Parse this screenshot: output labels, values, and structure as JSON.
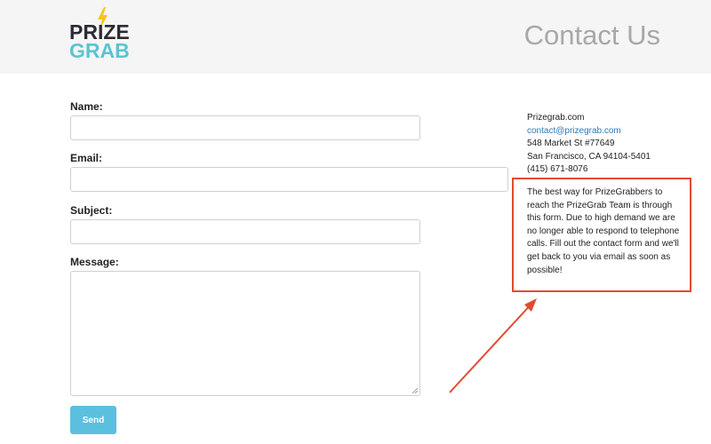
{
  "header": {
    "logo_top": "PRIZE",
    "logo_bottom": "GRAB",
    "title": "Contact Us"
  },
  "form": {
    "name_label": "Name:",
    "email_label": "Email:",
    "subject_label": "Subject:",
    "message_label": "Message:",
    "name_value": "",
    "email_value": "",
    "subject_value": "",
    "message_value": "",
    "send_label": "Send"
  },
  "contact": {
    "company": "Prizegrab.com",
    "email": "contact@prizegrab.com",
    "address_line1": "548 Market St #77649",
    "address_line2": "San Francisco, CA 94104-5401",
    "phone": "(415) 671-8076"
  },
  "notice": {
    "text": "The best way for PrizeGrabbers to reach the PrizeGrab Team is through this form. Due to high demand we are no longer able to respond to telephone calls. Fill out the contact form and we'll get back to you via email as soon as possible!"
  },
  "colors": {
    "accent_button": "#5bc0de",
    "logo_teal": "#5bc4d1",
    "logo_dark": "#2b2b33",
    "bolt_yellow": "#f5c518",
    "annotation_red": "#e34b2e",
    "link_blue": "#2a7ab8"
  }
}
